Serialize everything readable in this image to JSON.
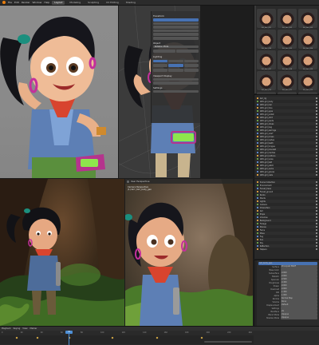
{
  "topbar": {
    "menus": [
      "File",
      "Edit",
      "Render",
      "Window",
      "Help"
    ],
    "workspaces": [
      "Layout",
      "Modeling",
      "Sculpting",
      "UV Editing",
      "Shading"
    ],
    "active_workspace": "Layout"
  },
  "viewports": {
    "material": {
      "header": "User Perspective",
      "overlay_line1": "Camera Perspective",
      "overlay_line2": "(1) Girl | Girl_body_geo"
    }
  },
  "npanel": {
    "transform": "Transform",
    "object_label": "Object",
    "rotation_mode": "Rotation Mode",
    "lighting": "Lighting",
    "viewport_display": "Viewport Display",
    "settings": "Settings"
  },
  "asset_browser": {
    "items": [
      "Girl_face_001",
      "Girl_face_002",
      "Girl_face_003",
      "Girl_face_004",
      "Girl_face_005",
      "Girl_face_006",
      "Girl_face_007",
      "Girl_face_008",
      "Girl_face_009",
      "Girl_face_010",
      "Girl_face_011",
      "Girl_face_012",
      "Girl_face_013",
      "Girl_face_014",
      "Girl_face_015"
    ]
  },
  "outliner": {
    "rows": [
      "Girl_rig",
      "GEO-girl_body",
      "GEO-girl_hair",
      "GEO-girl_face",
      "GEO-girl_eyes",
      "GEO-girl_jacket",
      "GEO-girl_shirt",
      "GEO-girl_pants",
      "GEO-girl_shoes",
      "GEO-girl_bag",
      "GEO-girl_earrings",
      "GEO-girl_scarf",
      "GEO-girl_brows",
      "GEO-girl_lashes",
      "GEO-girl_teeth",
      "GEO-girl_tongue",
      "GEO-girl_bracelet",
      "GEO-girl_hairties",
      "GEO-girl_buttons",
      "GEO-girl_laces",
      "GEO-girl_belt",
      "GEO-girl_patch",
      "GEO-girl_socks",
      "GEO-girl_gloves",
      "GEO-girl_nails"
    ]
  },
  "outliner2": {
    "rows": [
      "Scene Collection",
      "Environment",
      "Forest_trees",
      "Forest_ground",
      "Rocks",
      "Plants",
      "Lights",
      "Camera",
      "Characters",
      "Girl",
      "Props",
      "Volumes",
      "Background",
      "Foliage",
      "Stones",
      "Ferns",
      "Moss",
      "Fog",
      "Sun",
      "Sky",
      "Reflection",
      "Helpers"
    ]
  },
  "properties": {
    "section": "Girl_body_geo",
    "rows": [
      {
        "k": "Surface",
        "v": "Principled BSDF"
      },
      {
        "k": "Base Color",
        "v": ""
      },
      {
        "k": "Subsurface",
        "v": "0.000"
      },
      {
        "k": "Metallic",
        "v": "0.000"
      },
      {
        "k": "Specular",
        "v": "0.500"
      },
      {
        "k": "Roughness",
        "v": "0.450"
      },
      {
        "k": "Sheen",
        "v": "0.000"
      },
      {
        "k": "Clearcoat",
        "v": "0.000"
      },
      {
        "k": "IOR",
        "v": "1.450"
      },
      {
        "k": "Alpha",
        "v": "1.000"
      },
      {
        "k": "Normal",
        "v": "Normal Map"
      },
      {
        "k": "Volume",
        "v": "None"
      },
      {
        "k": "Displacement",
        "v": "Default"
      },
      {
        "k": "Settings",
        "v": ""
      },
      {
        "k": "Backface",
        "v": "On"
      },
      {
        "k": "Blend Mode",
        "v": "Opaque"
      },
      {
        "k": "Shadow Mode",
        "v": "Opaque"
      }
    ]
  },
  "timeline": {
    "menus": [
      "Playback",
      "Keying",
      "View",
      "Marker"
    ],
    "current_frame": "32",
    "ruler": [
      "0",
      "20",
      "40",
      "60",
      "80",
      "100",
      "120",
      "140",
      "160",
      "180",
      "200",
      "220",
      "240"
    ]
  }
}
